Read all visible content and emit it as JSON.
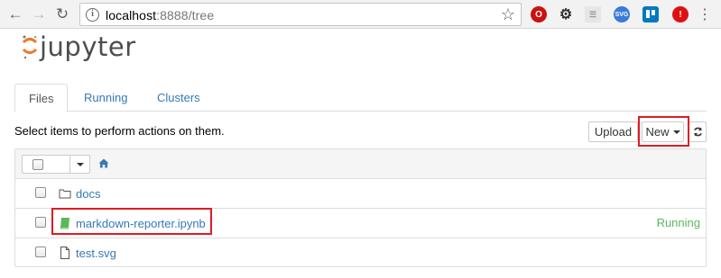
{
  "browser": {
    "url_host": "localhost",
    "url_path": ":8888/tree"
  },
  "app": {
    "logo_text": "jupyter",
    "brand_color": "#f37726"
  },
  "tabs": [
    {
      "label": "Files",
      "active": true
    },
    {
      "label": "Running",
      "active": false
    },
    {
      "label": "Clusters",
      "active": false
    }
  ],
  "toolbar": {
    "hint": "Select items to perform actions on them.",
    "upload_label": "Upload",
    "new_label": "New"
  },
  "files": [
    {
      "name": "docs",
      "type": "folder",
      "status": ""
    },
    {
      "name": "markdown-reporter.ipynb",
      "type": "notebook",
      "status": "Running"
    },
    {
      "name": "test.svg",
      "type": "file",
      "status": ""
    }
  ],
  "colors": {
    "link": "#337ab7",
    "running": "#5cb85c",
    "highlight": "#e01b24",
    "notebook_icon": "#5cb85c"
  }
}
